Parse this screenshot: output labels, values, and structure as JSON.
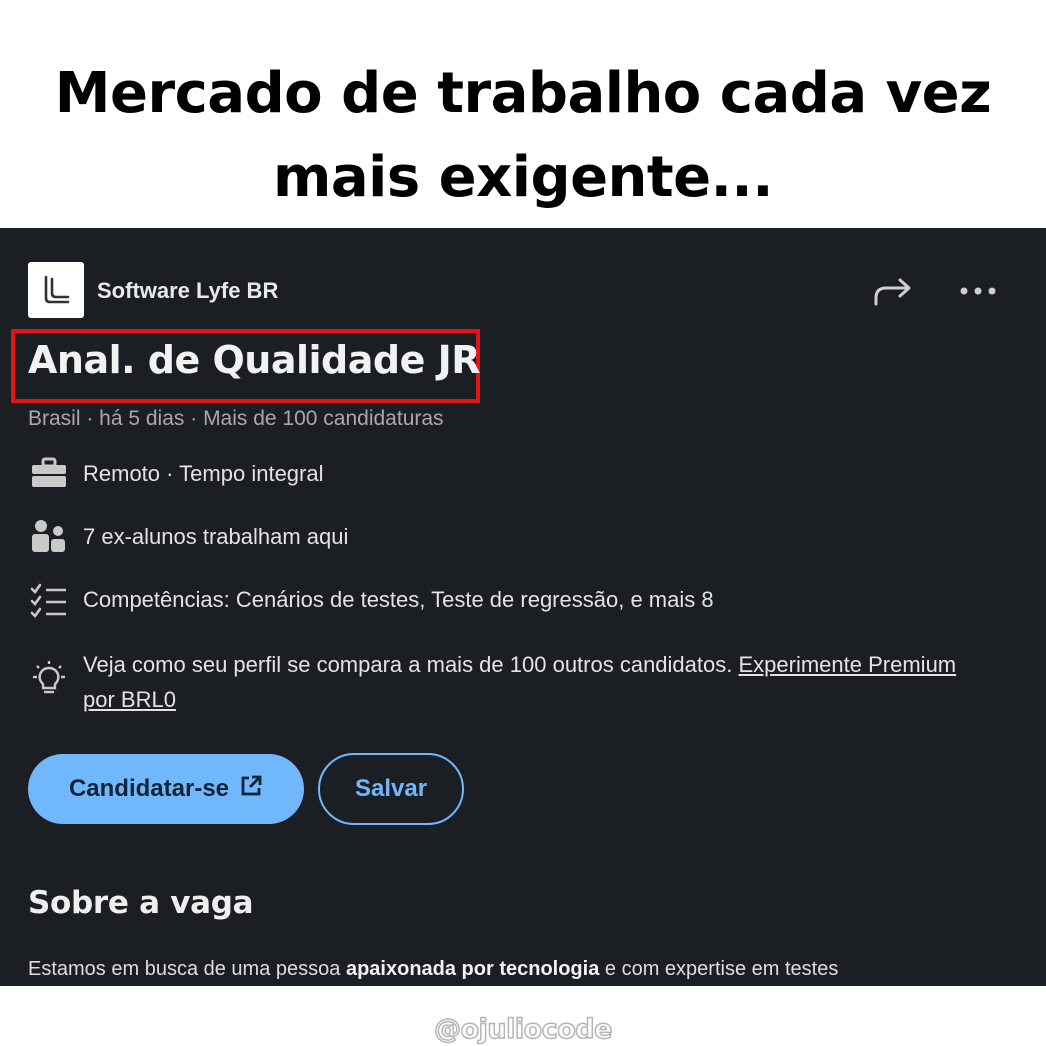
{
  "meme": {
    "title_line1": "Mercado de trabalho cada vez",
    "title_line2": "mais exigente..."
  },
  "job": {
    "company": "Software Lyfe BR",
    "title": "Anal. de Qualidade JR",
    "meta": "Brasil · há 5 dias · Mais de 100 candidaturas",
    "work_type": "Remoto · Tempo integral",
    "alumni": "7 ex-alunos trabalham aqui",
    "skills": "Competências: Cenários de testes, Teste de regressão, e mais 8",
    "insight_text": "Veja como seu perfil se compara a mais de 100 outros candidatos.",
    "insight_link": "Experimente Premium por BRL0",
    "apply_label": "Candidatar-se",
    "save_label": "Salvar",
    "section_title": "Sobre a vaga",
    "desc_start": "Estamos em busca de uma pessoa",
    "desc_bold": "apaixonada por tecnologia",
    "desc_end": "e com expertise em testes"
  },
  "icons": {
    "logo": "company-logo-icon",
    "share": "share-arrow-icon",
    "more": "more-options-icon",
    "work": "briefcase-icon",
    "alumni": "people-icon",
    "skills": "checklist-icon",
    "insight": "lightbulb-icon",
    "external": "external-link-icon"
  },
  "colors": {
    "card_bg": "#1b1f23",
    "accent": "#71b7fb",
    "highlight_box": "#e01515"
  },
  "watermark": "@ojuliocode"
}
